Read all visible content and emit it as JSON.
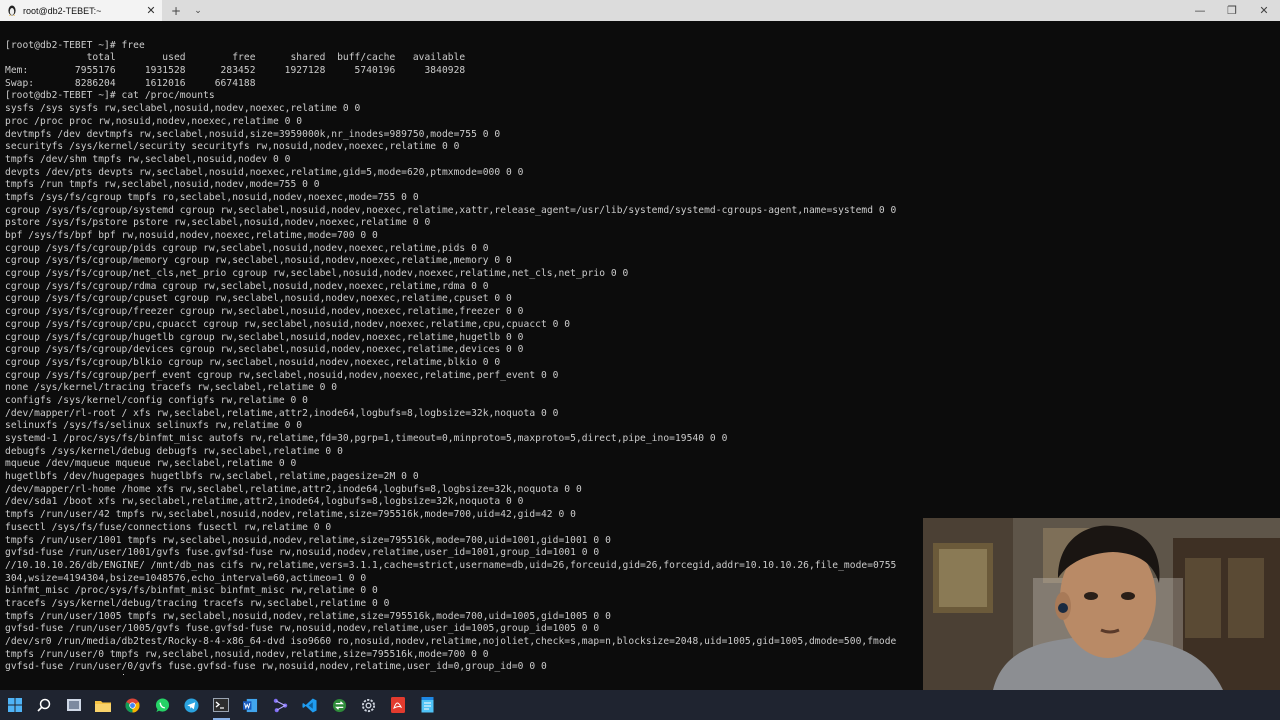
{
  "window": {
    "tab_title": "root@db2-TEBET:~",
    "close_glyph": "✕",
    "new_tab_glyph": "+",
    "dropdown_glyph": "⌄",
    "minimize_glyph": "—",
    "maximize_glyph": "❐",
    "window_close_glyph": "✕"
  },
  "terminal": {
    "lines": [
      "[root@db2-TEBET ~]# free",
      "              total        used        free      shared  buff/cache   available",
      "Mem:        7955176     1931528      283452     1927128     5740196     3840928",
      "Swap:       8286204     1612016     6674188",
      "[root@db2-TEBET ~]# cat /proc/mounts",
      "sysfs /sys sysfs rw,seclabel,nosuid,nodev,noexec,relatime 0 0",
      "proc /proc proc rw,nosuid,nodev,noexec,relatime 0 0",
      "devtmpfs /dev devtmpfs rw,seclabel,nosuid,size=3959000k,nr_inodes=989750,mode=755 0 0",
      "securityfs /sys/kernel/security securityfs rw,nosuid,nodev,noexec,relatime 0 0",
      "tmpfs /dev/shm tmpfs rw,seclabel,nosuid,nodev 0 0",
      "devpts /dev/pts devpts rw,seclabel,nosuid,noexec,relatime,gid=5,mode=620,ptmxmode=000 0 0",
      "tmpfs /run tmpfs rw,seclabel,nosuid,nodev,mode=755 0 0",
      "tmpfs /sys/fs/cgroup tmpfs ro,seclabel,nosuid,nodev,noexec,mode=755 0 0",
      "cgroup /sys/fs/cgroup/systemd cgroup rw,seclabel,nosuid,nodev,noexec,relatime,xattr,release_agent=/usr/lib/systemd/systemd-cgroups-agent,name=systemd 0 0",
      "pstore /sys/fs/pstore pstore rw,seclabel,nosuid,nodev,noexec,relatime 0 0",
      "bpf /sys/fs/bpf bpf rw,nosuid,nodev,noexec,relatime,mode=700 0 0",
      "cgroup /sys/fs/cgroup/pids cgroup rw,seclabel,nosuid,nodev,noexec,relatime,pids 0 0",
      "cgroup /sys/fs/cgroup/memory cgroup rw,seclabel,nosuid,nodev,noexec,relatime,memory 0 0",
      "cgroup /sys/fs/cgroup/net_cls,net_prio cgroup rw,seclabel,nosuid,nodev,noexec,relatime,net_cls,net_prio 0 0",
      "cgroup /sys/fs/cgroup/rdma cgroup rw,seclabel,nosuid,nodev,noexec,relatime,rdma 0 0",
      "cgroup /sys/fs/cgroup/cpuset cgroup rw,seclabel,nosuid,nodev,noexec,relatime,cpuset 0 0",
      "cgroup /sys/fs/cgroup/freezer cgroup rw,seclabel,nosuid,nodev,noexec,relatime,freezer 0 0",
      "cgroup /sys/fs/cgroup/cpu,cpuacct cgroup rw,seclabel,nosuid,nodev,noexec,relatime,cpu,cpuacct 0 0",
      "cgroup /sys/fs/cgroup/hugetlb cgroup rw,seclabel,nosuid,nodev,noexec,relatime,hugetlb 0 0",
      "cgroup /sys/fs/cgroup/devices cgroup rw,seclabel,nosuid,nodev,noexec,relatime,devices 0 0",
      "cgroup /sys/fs/cgroup/blkio cgroup rw,seclabel,nosuid,nodev,noexec,relatime,blkio 0 0",
      "cgroup /sys/fs/cgroup/perf_event cgroup rw,seclabel,nosuid,nodev,noexec,relatime,perf_event 0 0",
      "none /sys/kernel/tracing tracefs rw,seclabel,relatime 0 0",
      "configfs /sys/kernel/config configfs rw,relatime 0 0",
      "/dev/mapper/rl-root / xfs rw,seclabel,relatime,attr2,inode64,logbufs=8,logbsize=32k,noquota 0 0",
      "selinuxfs /sys/fs/selinux selinuxfs rw,relatime 0 0",
      "systemd-1 /proc/sys/fs/binfmt_misc autofs rw,relatime,fd=30,pgrp=1,timeout=0,minproto=5,maxproto=5,direct,pipe_ino=19540 0 0",
      "debugfs /sys/kernel/debug debugfs rw,seclabel,relatime 0 0",
      "mqueue /dev/mqueue mqueue rw,seclabel,relatime 0 0",
      "hugetlbfs /dev/hugepages hugetlbfs rw,seclabel,relatime,pagesize=2M 0 0",
      "/dev/mapper/rl-home /home xfs rw,seclabel,relatime,attr2,inode64,logbufs=8,logbsize=32k,noquota 0 0",
      "/dev/sda1 /boot xfs rw,seclabel,relatime,attr2,inode64,logbufs=8,logbsize=32k,noquota 0 0",
      "tmpfs /run/user/42 tmpfs rw,seclabel,nosuid,nodev,relatime,size=795516k,mode=700,uid=42,gid=42 0 0",
      "fusectl /sys/fs/fuse/connections fusectl rw,relatime 0 0",
      "tmpfs /run/user/1001 tmpfs rw,seclabel,nosuid,nodev,relatime,size=795516k,mode=700,uid=1001,gid=1001 0 0",
      "gvfsd-fuse /run/user/1001/gvfs fuse.gvfsd-fuse rw,nosuid,nodev,relatime,user_id=1001,group_id=1001 0 0",
      "//10.10.10.26/db/ENGINE/ /mnt/db_nas cifs rw,relatime,vers=3.1.1,cache=strict,username=db,uid=26,forceuid,gid=26,forcegid,addr=10.10.10.26,file_mode=0755",
      "304,wsize=4194304,bsize=1048576,echo_interval=60,actimeo=1 0 0",
      "binfmt_misc /proc/sys/fs/binfmt_misc binfmt_misc rw,relatime 0 0",
      "tracefs /sys/kernel/debug/tracing tracefs rw,seclabel,relatime 0 0",
      "tmpfs /run/user/1005 tmpfs rw,seclabel,nosuid,nodev,relatime,size=795516k,mode=700,uid=1005,gid=1005 0 0",
      "gvfsd-fuse /run/user/1005/gvfs fuse.gvfsd-fuse rw,nosuid,nodev,relatime,user_id=1005,group_id=1005 0 0",
      "/dev/sr0 /run/media/db2test/Rocky-8-4-x86_64-dvd iso9660 ro,nosuid,nodev,relatime,nojoliet,check=s,map=n,blocksize=2048,uid=1005,gid=1005,dmode=500,fmode",
      "tmpfs /run/user/0 tmpfs rw,seclabel,nosuid,nodev,relatime,size=795516k,mode=700 0 0",
      "gvfsd-fuse /run/user/0/gvfs fuse.gvfsd-fuse rw,nosuid,nodev,relatime,user_id=0,group_id=0 0 0"
    ],
    "prompt": "[root@db2-TEBET ~]# "
  },
  "taskbar": {
    "items": [
      {
        "name": "start-button",
        "icon": "windows-logo"
      },
      {
        "name": "search-button",
        "icon": "search-icon"
      },
      {
        "name": "task-view-button",
        "icon": "task-view-icon"
      },
      {
        "name": "file-explorer-app",
        "icon": "folder-icon"
      },
      {
        "name": "chrome-app",
        "icon": "chrome-icon"
      },
      {
        "name": "whatsapp-app",
        "icon": "whatsapp-icon"
      },
      {
        "name": "telegram-app",
        "icon": "telegram-icon"
      },
      {
        "name": "terminal-app",
        "icon": "terminal-icon"
      },
      {
        "name": "word-app",
        "icon": "word-icon"
      },
      {
        "name": "network-tool-app",
        "icon": "network-icon"
      },
      {
        "name": "vscode-app",
        "icon": "vscode-icon"
      },
      {
        "name": "winscp-app",
        "icon": "transfer-icon"
      },
      {
        "name": "settings-app",
        "icon": "gear-icon"
      },
      {
        "name": "pdf-app",
        "icon": "pdf-icon"
      },
      {
        "name": "notepad-app",
        "icon": "notepad-icon"
      }
    ]
  },
  "colors": {
    "terminal_bg": "#0c0c0c",
    "terminal_fg": "#cccccc",
    "titlebar_bg": "#dcdcdc",
    "taskbar_bg": "#1f2430"
  }
}
